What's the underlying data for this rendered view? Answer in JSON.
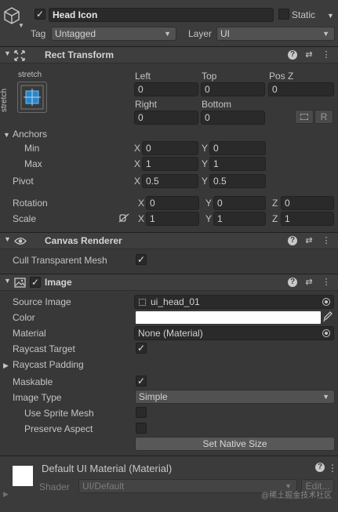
{
  "header": {
    "object_name": "Head Icon",
    "static_label": "Static",
    "tag_label": "Tag",
    "tag_value": "Untagged",
    "layer_label": "Layer",
    "layer_value": "UI"
  },
  "rect_transform": {
    "title": "Rect Transform",
    "stretch_top": "stretch",
    "stretch_side": "stretch",
    "left_label": "Left",
    "left_value": "0",
    "top_label": "Top",
    "top_value": "0",
    "posz_label": "Pos Z",
    "posz_value": "0",
    "right_label": "Right",
    "right_value": "0",
    "bottom_label": "Bottom",
    "bottom_value": "0",
    "r_button": "R",
    "anchors_label": "Anchors",
    "min_label": "Min",
    "min_x": "0",
    "min_y": "0",
    "max_label": "Max",
    "max_x": "1",
    "max_y": "1",
    "pivot_label": "Pivot",
    "pivot_x": "0.5",
    "pivot_y": "0.5",
    "rotation_label": "Rotation",
    "rot_x": "0",
    "rot_y": "0",
    "rot_z": "0",
    "scale_label": "Scale",
    "scale_x": "1",
    "scale_y": "1",
    "scale_z": "1",
    "axis_x": "X",
    "axis_y": "Y",
    "axis_z": "Z"
  },
  "canvas_renderer": {
    "title": "Canvas Renderer",
    "cull_label": "Cull Transparent Mesh",
    "cull_checked": "✓"
  },
  "image": {
    "title": "Image",
    "source_label": "Source Image",
    "source_value": "ui_head_01",
    "color_label": "Color",
    "color_value": "#ffffff",
    "material_label": "Material",
    "material_value": "None (Material)",
    "raycast_target_label": "Raycast Target",
    "raycast_target_checked": "✓",
    "raycast_padding_label": "Raycast Padding",
    "maskable_label": "Maskable",
    "maskable_checked": "✓",
    "image_type_label": "Image Type",
    "image_type_value": "Simple",
    "use_sprite_mesh_label": "Use Sprite Mesh",
    "preserve_aspect_label": "Preserve Aspect",
    "set_native_size": "Set Native Size"
  },
  "material": {
    "title": "Default UI Material (Material)",
    "shader_label": "Shader",
    "shader_value": "UI/Default",
    "edit_button": "Edit..."
  },
  "watermark": "@稀土掘金技术社区",
  "check_mark": "✓",
  "colors": {
    "background": "#383838",
    "field": "#2a2a2a",
    "header": "#3e3e3e"
  }
}
